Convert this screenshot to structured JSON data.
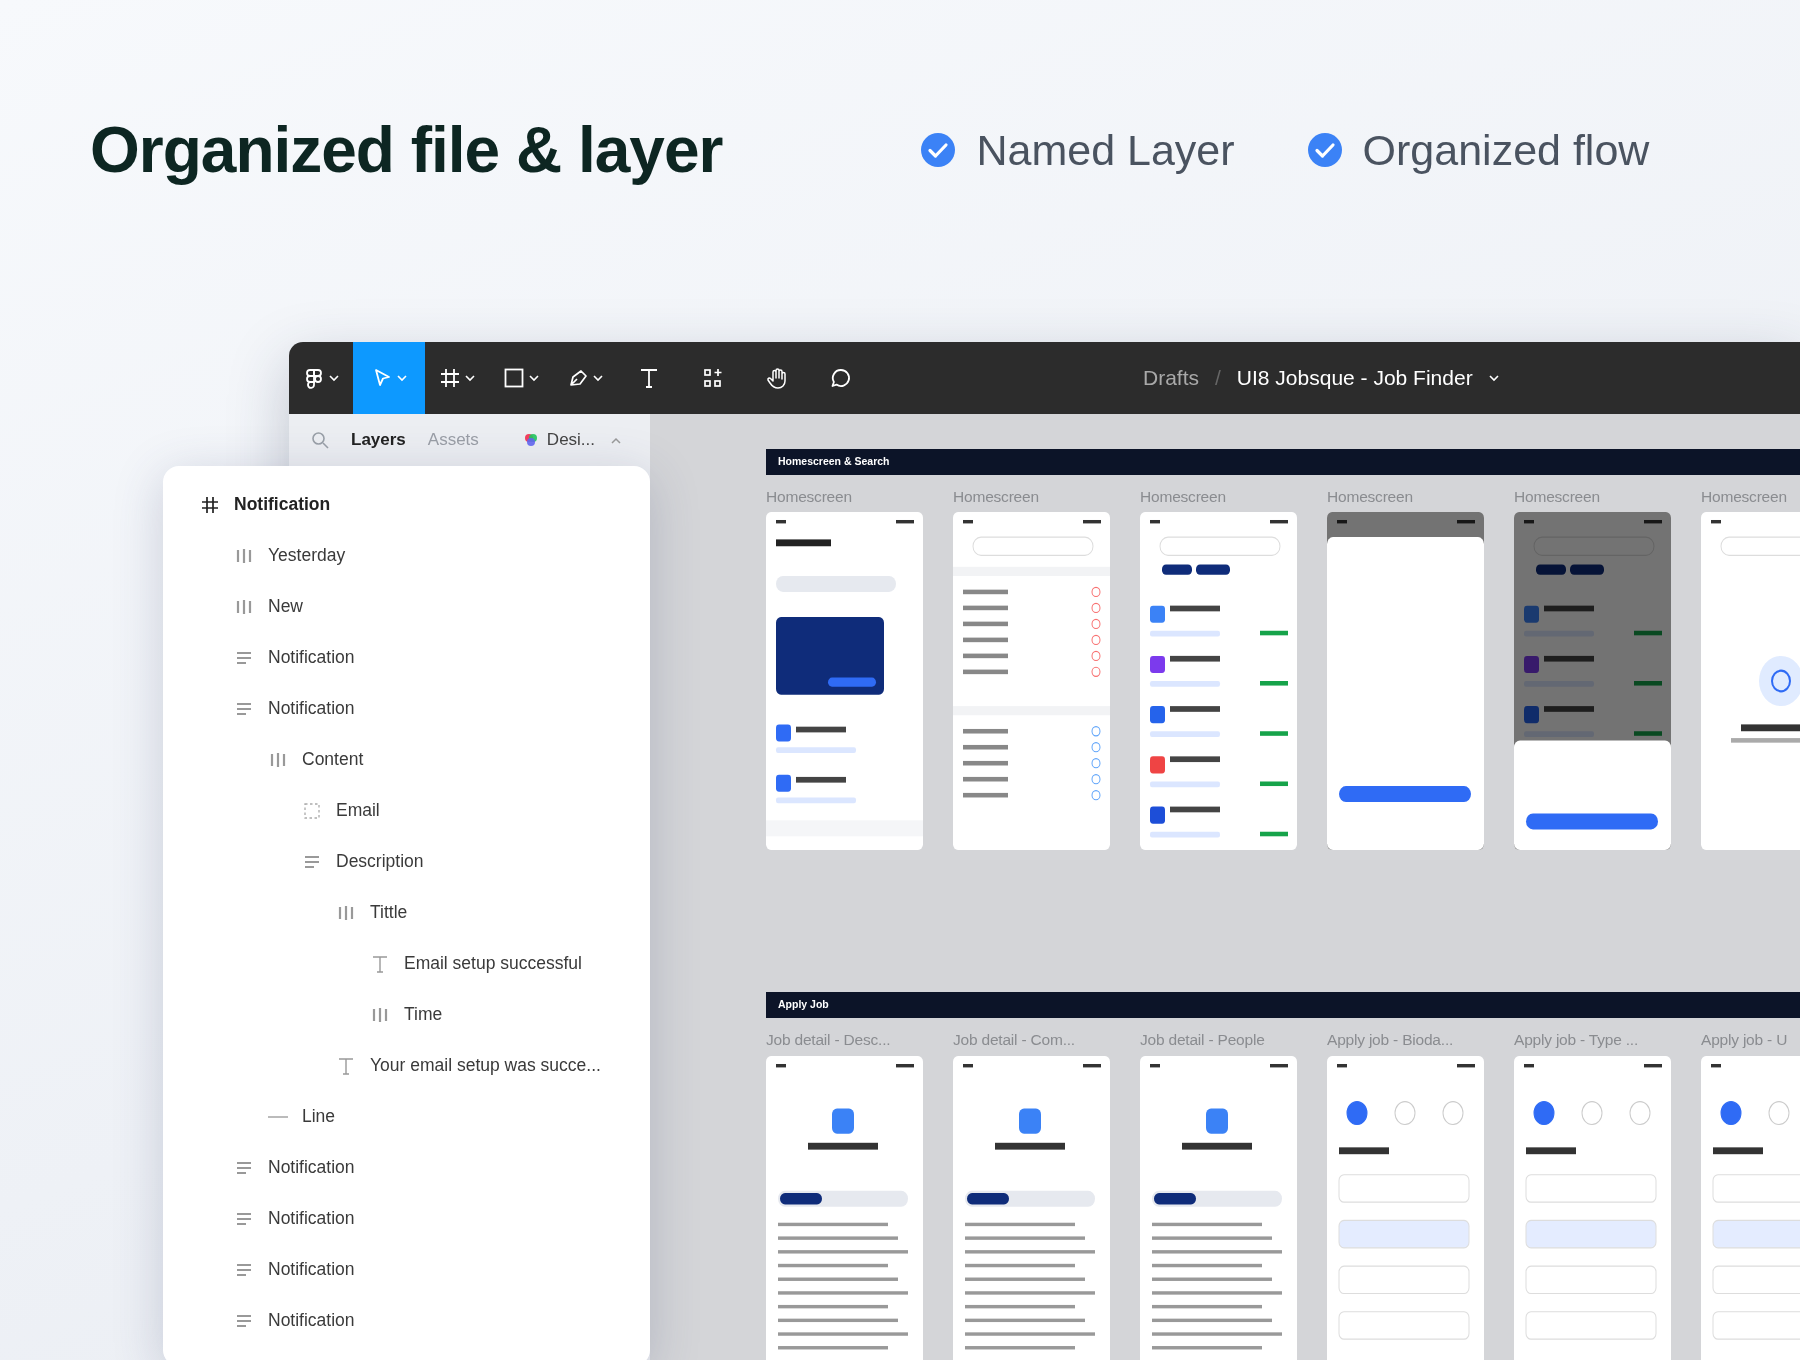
{
  "headline": "Organized file & layer",
  "features": [
    {
      "label": "Named Layer",
      "checked": true
    },
    {
      "label": "Organized flow",
      "checked": true
    }
  ],
  "toolbar": {
    "tools": [
      {
        "kind": "logo",
        "selected": false
      },
      {
        "kind": "move",
        "selected": true
      },
      {
        "kind": "frame",
        "selected": false
      },
      {
        "kind": "rectangle",
        "selected": false
      },
      {
        "kind": "pen",
        "selected": false
      },
      {
        "kind": "text",
        "selected": false
      },
      {
        "kind": "components",
        "selected": false
      },
      {
        "kind": "hand",
        "selected": false
      },
      {
        "kind": "comment",
        "selected": false
      }
    ],
    "breadcrumb": {
      "folder": "Drafts",
      "separator": "/",
      "file": "UI8 Jobsque - Job Finder"
    }
  },
  "panel_tabs": [
    {
      "label": "Layers",
      "selected": true
    },
    {
      "label": "Assets",
      "selected": false
    }
  ],
  "page_selector": "Desi...",
  "layers": [
    {
      "name": "Notification",
      "kind": "frame",
      "children": [
        {
          "name": "Yesterday",
          "kind": "vstack"
        },
        {
          "name": "New",
          "kind": "vstack"
        },
        {
          "name": "Notification",
          "kind": "hstack"
        },
        {
          "name": "Notification",
          "kind": "hstack",
          "children": [
            {
              "name": "Content",
              "kind": "vstack",
              "children": [
                {
                  "name": "Email",
                  "kind": "placeholder"
                },
                {
                  "name": "Description",
                  "kind": "hstack",
                  "children": [
                    {
                      "name": "Tittle",
                      "kind": "vstack",
                      "children": [
                        {
                          "name": "Email setup successful",
                          "kind": "text"
                        },
                        {
                          "name": "Time",
                          "kind": "vstack"
                        }
                      ]
                    },
                    {
                      "name": "Your email setup was succe...",
                      "kind": "text"
                    }
                  ]
                }
              ]
            },
            {
              "name": "Line",
              "kind": "line"
            }
          ]
        },
        {
          "name": "Notification",
          "kind": "hstack"
        },
        {
          "name": "Notification",
          "kind": "hstack"
        },
        {
          "name": "Notification",
          "kind": "hstack"
        },
        {
          "name": "Notification",
          "kind": "hstack"
        }
      ]
    }
  ],
  "sections": [
    {
      "title": "Homescreen & Search",
      "frames": [
        {
          "label": "Homescreen",
          "kind": "home",
          "dimmed": false
        },
        {
          "label": "Homescreen",
          "kind": "search",
          "dimmed": false
        },
        {
          "label": "Homescreen",
          "kind": "results",
          "dimmed": false
        },
        {
          "label": "Homescreen",
          "kind": "filter",
          "dimmed": true
        },
        {
          "label": "Homescreen",
          "kind": "results",
          "dimmed": true
        },
        {
          "label": "Homescreen",
          "kind": "empty",
          "dimmed": false
        }
      ]
    },
    {
      "title": "Apply Job",
      "frames": [
        {
          "label": "Job detail - Desc...",
          "kind": "detail",
          "dimmed": false
        },
        {
          "label": "Job detail - Com...",
          "kind": "detail",
          "dimmed": false
        },
        {
          "label": "Job detail - People",
          "kind": "detail",
          "dimmed": false
        },
        {
          "label": "Apply job - Bioda...",
          "kind": "form",
          "dimmed": false
        },
        {
          "label": "Apply job - Type ...",
          "kind": "form",
          "dimmed": false
        },
        {
          "label": "Apply job - U",
          "kind": "form",
          "dimmed": false
        }
      ]
    }
  ]
}
